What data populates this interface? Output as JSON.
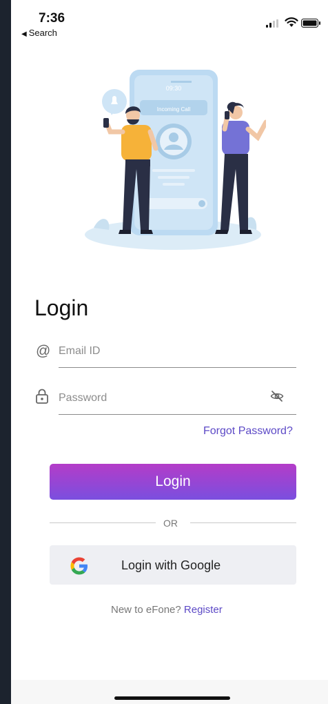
{
  "status_bar": {
    "time": "7:36",
    "back_label": "Search"
  },
  "illustration": {
    "phone_time": "09:30",
    "phone_caption": "Incoming Call"
  },
  "login": {
    "title": "Login",
    "email_placeholder": "Email ID",
    "password_placeholder": "Password",
    "forgot_password": "Forgot Password?",
    "login_button": "Login",
    "or_divider": "OR",
    "google_button": "Login with Google",
    "register_prompt": "New to eFone?",
    "register_link": "Register"
  },
  "colors": {
    "accent": "#5c49c6",
    "button_gradient_start": "#b43cc8",
    "button_gradient_end": "#7a4fdf",
    "google_button_bg": "#eeeff3"
  },
  "icons": [
    "at-icon",
    "lock-icon",
    "eye-off-icon",
    "google-icon",
    "signal-icon",
    "wifi-icon",
    "battery-icon"
  ]
}
